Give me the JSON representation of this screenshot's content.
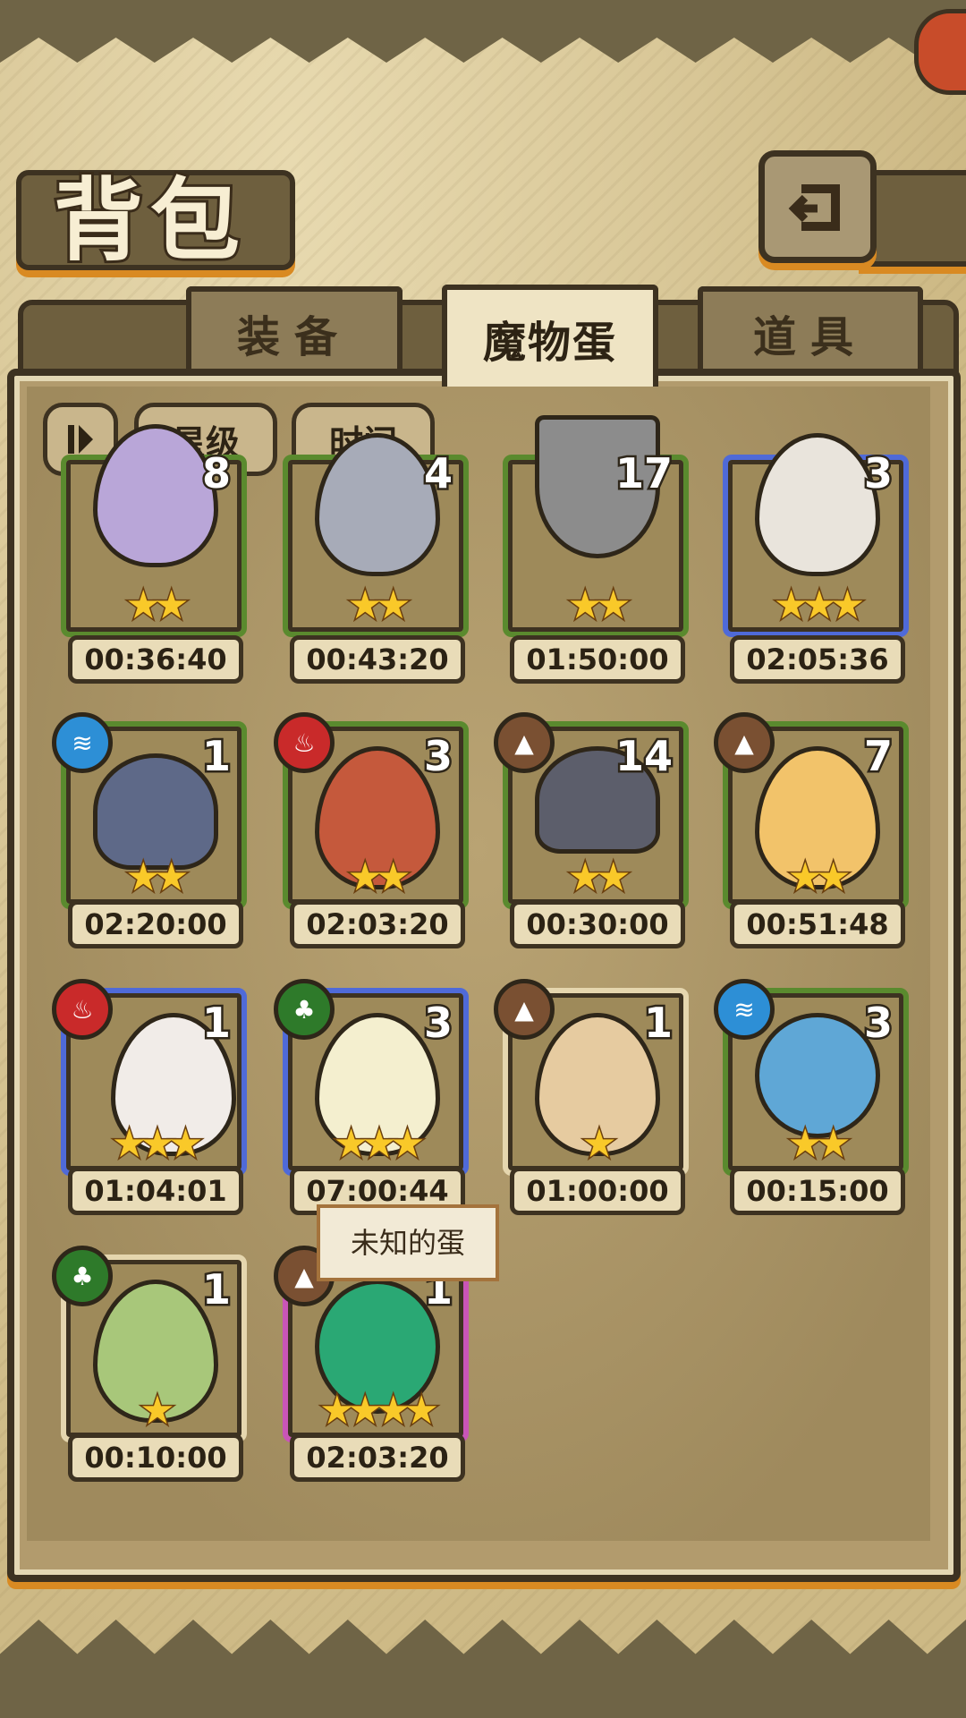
{
  "header": {
    "title": "背包"
  },
  "tabs": [
    {
      "label": "装备",
      "active": false
    },
    {
      "label": "魔物蛋",
      "active": true
    },
    {
      "label": "道具",
      "active": false
    }
  ],
  "sort": {
    "toggle_icon": "sort-order-icon",
    "star_label": "星级",
    "time_label": "时间"
  },
  "tooltip": "未知的蛋",
  "colors": {
    "grass": "#5a8a2e",
    "rare": "#4f6ad8",
    "epic": "#c955b7",
    "common": "#e5d6ae",
    "star": "#f9c929"
  },
  "eggs": [
    {
      "count": "8",
      "stars": "★★",
      "time": "00:36:40",
      "element": "fire-icon"
    },
    {
      "count": "4",
      "stars": "★★",
      "time": "00:43:20",
      "element": "earth-icon"
    },
    {
      "count": "17",
      "stars": "★★",
      "time": "01:50:00",
      "element": "earth-icon"
    },
    {
      "count": "3",
      "stars": "★★★",
      "time": "02:05:36",
      "element": "leaf-icon"
    },
    {
      "count": "1",
      "stars": "★★",
      "time": "02:20:00",
      "element": "water-icon"
    },
    {
      "count": "3",
      "stars": "★★",
      "time": "02:03:20",
      "element": "fire-icon"
    },
    {
      "count": "14",
      "stars": "★★",
      "time": "00:30:00",
      "element": "earth-icon"
    },
    {
      "count": "7",
      "stars": "★★",
      "time": "00:51:48",
      "element": "earth-icon"
    },
    {
      "count": "1",
      "stars": "★★★",
      "time": "01:04:01",
      "element": "fire-icon"
    },
    {
      "count": "3",
      "stars": "★★★",
      "time": "07:00:44",
      "element": "leaf-icon"
    },
    {
      "count": "1",
      "stars": "★",
      "time": "01:00:00",
      "element": "earth-icon"
    },
    {
      "count": "3",
      "stars": "★★",
      "time": "00:15:00",
      "element": "water-icon"
    },
    {
      "count": "1",
      "stars": "★",
      "time": "00:10:00",
      "element": "leaf-icon"
    },
    {
      "count": "1",
      "stars": "★★★★",
      "time": "02:03:20",
      "element": "earth-icon"
    }
  ]
}
